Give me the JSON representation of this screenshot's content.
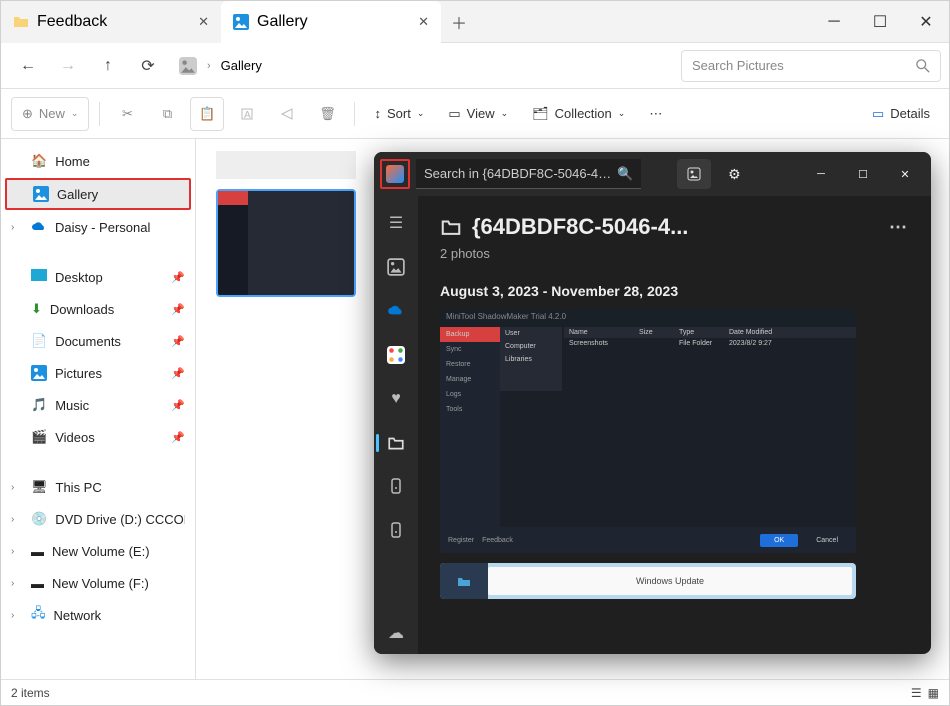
{
  "tabs": [
    {
      "label": "Feedback",
      "active": false
    },
    {
      "label": "Gallery",
      "active": true
    }
  ],
  "address": {
    "location": "Gallery"
  },
  "search": {
    "placeholder": "Search Pictures"
  },
  "toolbar": {
    "new": "New",
    "sort": "Sort",
    "view": "View",
    "collection": "Collection",
    "details": "Details"
  },
  "sidebar": {
    "home": "Home",
    "gallery": "Gallery",
    "onedrive": "Daisy - Personal",
    "desktop": "Desktop",
    "downloads": "Downloads",
    "documents": "Documents",
    "pictures": "Pictures",
    "music": "Music",
    "videos": "Videos",
    "thispc": "This PC",
    "dvd": "DVD Drive (D:) CCCOMA",
    "vole": "New Volume (E:)",
    "volf": "New Volume (F:)",
    "network": "Network"
  },
  "status": {
    "items": "2 items"
  },
  "photos": {
    "search_placeholder": "Search in {64DBDF8C-5046-4…",
    "title": "{64DBDF8C-5046-4...",
    "subtitle": "2 photos",
    "date_range": "August 3, 2023 - November 28, 2023",
    "thumb1": {
      "title": "MiniTool ShadowMaker Trial 4.2.0",
      "side": [
        "Backup",
        "Sync",
        "Restore",
        "Manage",
        "Logs",
        "Tools"
      ],
      "tree": [
        "User",
        "Computer",
        "Libraries"
      ],
      "cols": [
        "Name",
        "Size",
        "Type",
        "Date Modified"
      ],
      "row": [
        "Screenshots",
        "",
        "File Folder",
        "2023/8/2 9:27"
      ],
      "footer": [
        "Register",
        "Feedback"
      ],
      "ok": "OK",
      "cancel": "Cancel"
    },
    "thumb2": {
      "label": "Windows Update"
    }
  }
}
